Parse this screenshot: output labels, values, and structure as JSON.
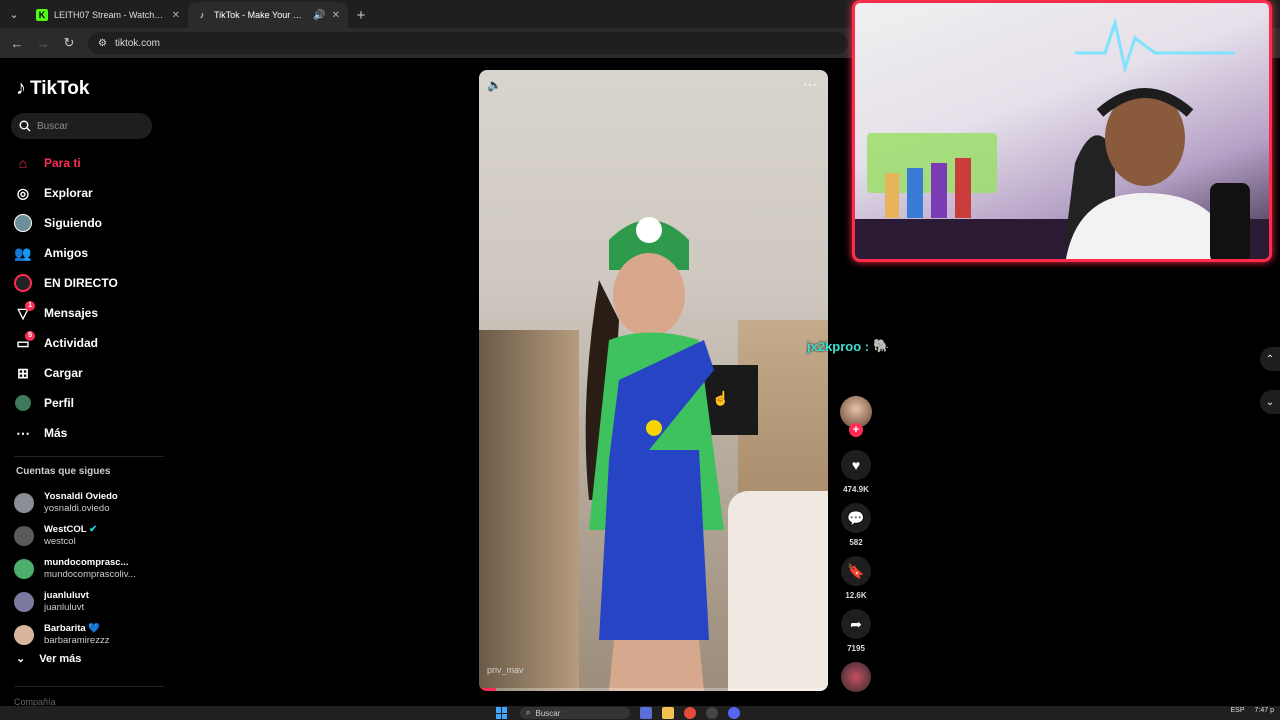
{
  "browser": {
    "tabs": [
      {
        "title": "LEITH07 Stream - Watch Live o",
        "favicon": "kick-icon",
        "favicon_color": "#53fc18",
        "active": false
      },
      {
        "title": "TikTok - Make Your Day",
        "favicon": "tiktok-icon",
        "favicon_color": "#ffffff",
        "active": true
      }
    ],
    "address": "tiktok.com"
  },
  "tiktok": {
    "logo_text": "TikTok",
    "search_placeholder": "Buscar",
    "nav": [
      {
        "label": "Para ti",
        "icon": "home-icon",
        "active": true
      },
      {
        "label": "Explorar",
        "icon": "compass-icon"
      },
      {
        "label": "Siguiendo",
        "icon": "following-avatar-icon"
      },
      {
        "label": "Amigos",
        "icon": "friends-icon"
      },
      {
        "label": "EN DIRECTO",
        "icon": "live-icon"
      },
      {
        "label": "Mensajes",
        "icon": "messages-icon",
        "badge": "1"
      },
      {
        "label": "Actividad",
        "icon": "activity-icon",
        "badge": "5"
      },
      {
        "label": "Cargar",
        "icon": "upload-icon"
      },
      {
        "label": "Perfil",
        "icon": "profile-icon"
      },
      {
        "label": "Más",
        "icon": "more-icon"
      }
    ],
    "following_title": "Cuentas que sigues",
    "following": [
      {
        "name": "Yosnaldi Oviedo",
        "handle": "yosnaldi.oviedo",
        "color": "#8a8f96"
      },
      {
        "name": "WestCOL",
        "handle": "westcol",
        "color": "#5a5a5a",
        "verified": true
      },
      {
        "name": "mundocomprasc...",
        "handle": "mundocomprascoliv...",
        "color": "#4caf6d"
      },
      {
        "name": "juanluluvt",
        "handle": "juanluluvt",
        "color": "#7a7aa0"
      },
      {
        "name": "Barbarita 💙",
        "handle": "barbaramirezzz",
        "color": "#d8b49a"
      }
    ],
    "see_more": "Ver más",
    "cut_text": "Compañía",
    "video": {
      "handle": "priv_mav",
      "progress": 0.05,
      "likes": "474.9K",
      "comments": "582",
      "saves": "12.6K",
      "shares": "7195"
    }
  },
  "stream_overlay": {
    "chat_user": "jx2kproo :",
    "chat_emote": "🐘"
  },
  "taskbar": {
    "search": "Buscar",
    "lang": "ESP",
    "time": "7:47 p"
  }
}
